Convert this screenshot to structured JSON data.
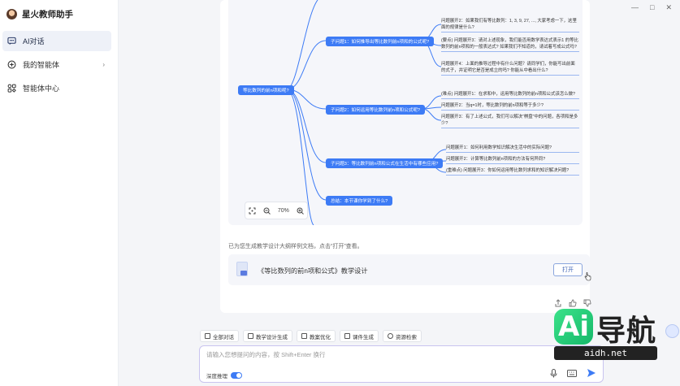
{
  "app": {
    "title": "星火教师助手"
  },
  "window_controls": [
    "—",
    "□",
    "✕"
  ],
  "sidebar": {
    "items": [
      {
        "label": "AI对话",
        "icon": "chat-icon",
        "active": true
      },
      {
        "label": "我的智能体",
        "icon": "agent-icon",
        "active": false,
        "has_chevron": true
      },
      {
        "label": "智能体中心",
        "icon": "grid-icon",
        "active": false
      }
    ]
  },
  "mindmap": {
    "root": "等比数列的前n项和呢?",
    "branches": [
      {
        "label": "子问题1：如何推导出等比数列前n项和的公式呢?",
        "leaves": [
          "问题展开2：如果我们有等比数列：1, 3, 9, 27, ..., 大家考虑一下，这里面的规律是什么?",
          "(要点) 问题展开3：请对上述现象，我们能否用数学表达式表示1 的等比数列的前n项和的一般表达式? 如果我们不知道的，请试着写成公式吗?",
          "问题展开4：上面的推导过程中有什么问题？请同学们，你能写出前面的式子，并证明它是否是成立的吗? 你能从中看出什么?"
        ]
      },
      {
        "label": "子问题2：如何运用等比数列前n项和公式呢?",
        "leaves": [
          "(难点) 问题展开1：在求和中，运用等比数列的前n项和公式该怎么做?",
          "问题展开2：当q=1时，等比数列的前n项和等于多少?",
          "问题展开3：有了上述公式，我们可以解决“棋盘”中的问题，各项和是多少?"
        ]
      },
      {
        "label": "子问题3：等比数列前n项和公式在生活中有哪些应用?",
        "leaves": [
          "问题展开1：如何利用数学知识解决生活中的实际问题?",
          "问题展开2：计算等比数列前n项和的方法有何异同?",
          "(重难点) 问题展开3：你如何运用等比数列求和的知识解决问题?"
        ]
      },
      {
        "label": "总结：本节课你学到了什么?",
        "leaves": []
      }
    ]
  },
  "zoom": {
    "level": "70%"
  },
  "notice": "已为您生成教学设计大纲样例文档，点击“打开”查看。",
  "document": {
    "title": "《等比数列的前n项和公式》教学设计",
    "open_label": "打开"
  },
  "toolbar": {
    "items": [
      {
        "label": "全部对话",
        "icon": "history-icon"
      },
      {
        "label": "教学设计生成",
        "icon": "pen-icon"
      },
      {
        "label": "教案优化",
        "icon": "edit-doc-icon"
      },
      {
        "label": "课件生成",
        "icon": "slides-icon"
      },
      {
        "label": "资源检索",
        "icon": "search-icon"
      }
    ]
  },
  "input": {
    "placeholder": "请输入您想提问的内容，按 Shift+Enter 换行",
    "deep_think_label": "深度推理"
  },
  "watermark": {
    "logo_text": "Ai",
    "cn_text": "导航",
    "url": "aidh.net"
  },
  "colors": {
    "accent": "#3d7bf5",
    "brand_green": "#22c77a"
  }
}
